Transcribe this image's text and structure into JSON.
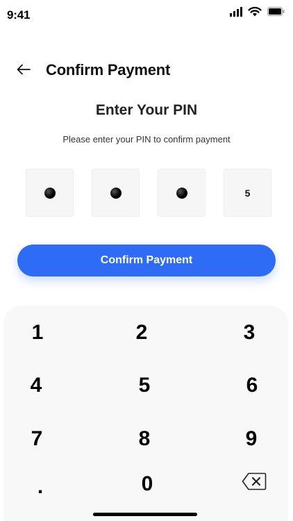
{
  "status_bar": {
    "time": "9:41"
  },
  "header": {
    "title": "Confirm Payment"
  },
  "pin": {
    "title": "Enter Your PIN",
    "subtitle": "Please enter your PIN to confirm payment",
    "slots": [
      "dot",
      "dot",
      "dot",
      "5"
    ],
    "last_digit": "5"
  },
  "confirm_button": {
    "label": "Confirm Payment"
  },
  "keypad": {
    "keys": [
      "1",
      "2",
      "3",
      "4",
      "5",
      "6",
      "7",
      "8",
      "9",
      ".",
      "0"
    ]
  },
  "colors": {
    "accent": "#2f6cf6",
    "pin_box_bg": "#f6f6f6",
    "keypad_bg": "#f8f8f8"
  },
  "icons": {
    "back": "arrow-left-icon",
    "backspace": "backspace-icon",
    "signal": "cellular-signal-icon",
    "wifi": "wifi-icon",
    "battery": "battery-icon"
  }
}
